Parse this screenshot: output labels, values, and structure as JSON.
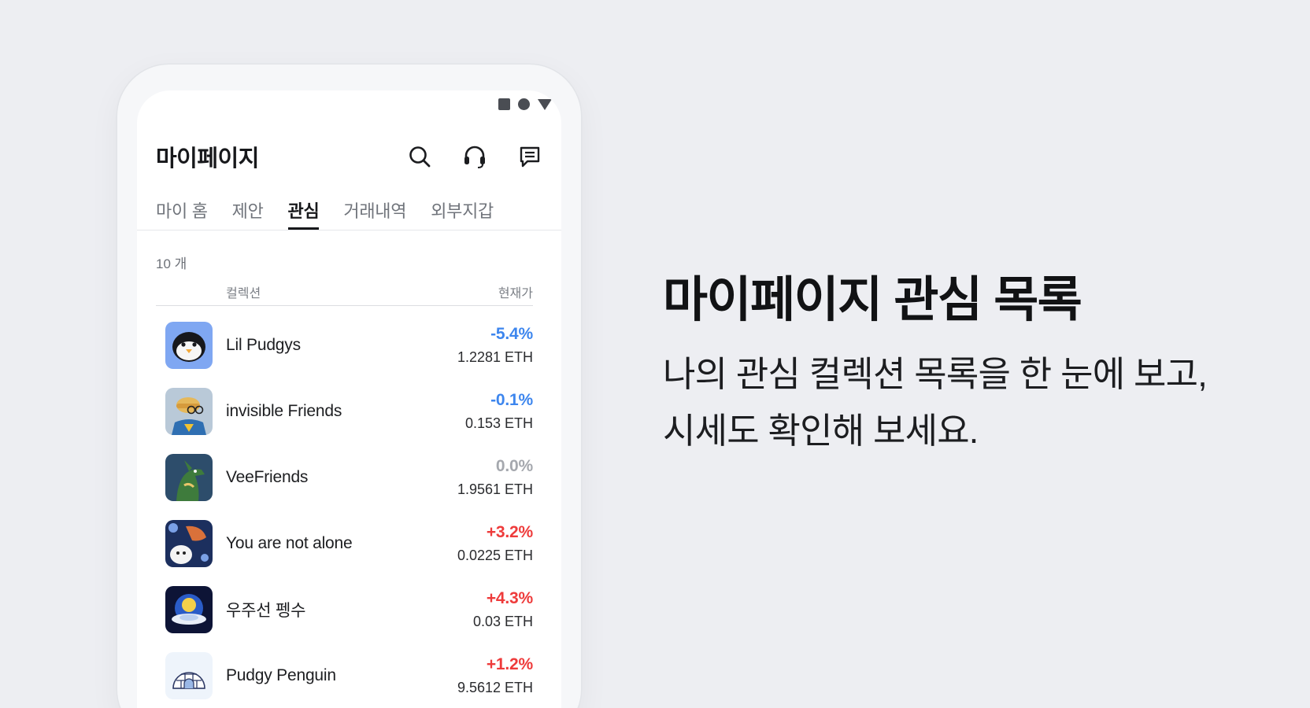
{
  "app": {
    "page_title": "마이페이지"
  },
  "header_icons": [
    "search-icon",
    "headset-icon",
    "chat-icon"
  ],
  "tabs": [
    {
      "label": "마이 홈",
      "active": false
    },
    {
      "label": "제안",
      "active": false
    },
    {
      "label": "관심",
      "active": true
    },
    {
      "label": "거래내역",
      "active": false
    },
    {
      "label": "외부지갑",
      "active": false
    }
  ],
  "list": {
    "count_label": "10 개",
    "col_collection": "컬렉션",
    "col_price": "현재가",
    "items": [
      {
        "name": "Lil Pudgys",
        "change": "-5.4%",
        "trend": "down",
        "price": "1.2281 ETH"
      },
      {
        "name": "invisible Friends",
        "change": "-0.1%",
        "trend": "down",
        "price": "0.153 ETH"
      },
      {
        "name": "VeeFriends",
        "change": "0.0%",
        "trend": "flat",
        "price": "1.9561 ETH"
      },
      {
        "name": "You are not alone",
        "change": "+3.2%",
        "trend": "up",
        "price": "0.0225 ETH"
      },
      {
        "name": "우주선 펭수",
        "change": "+4.3%",
        "trend": "up",
        "price": "0.03 ETH"
      },
      {
        "name": "Pudgy Penguin",
        "change": "+1.2%",
        "trend": "up",
        "price": "9.5612 ETH"
      }
    ]
  },
  "promo": {
    "title": "마이페이지 관심 목록",
    "line1": "나의 관심 컬렉션 목록을 한 눈에 보고,",
    "line2": "시세도 확인해 보세요."
  },
  "colors": {
    "background": "#edeef2",
    "down": "#3d86ee",
    "up": "#ee3b3b",
    "flat": "#a5a8ae"
  }
}
